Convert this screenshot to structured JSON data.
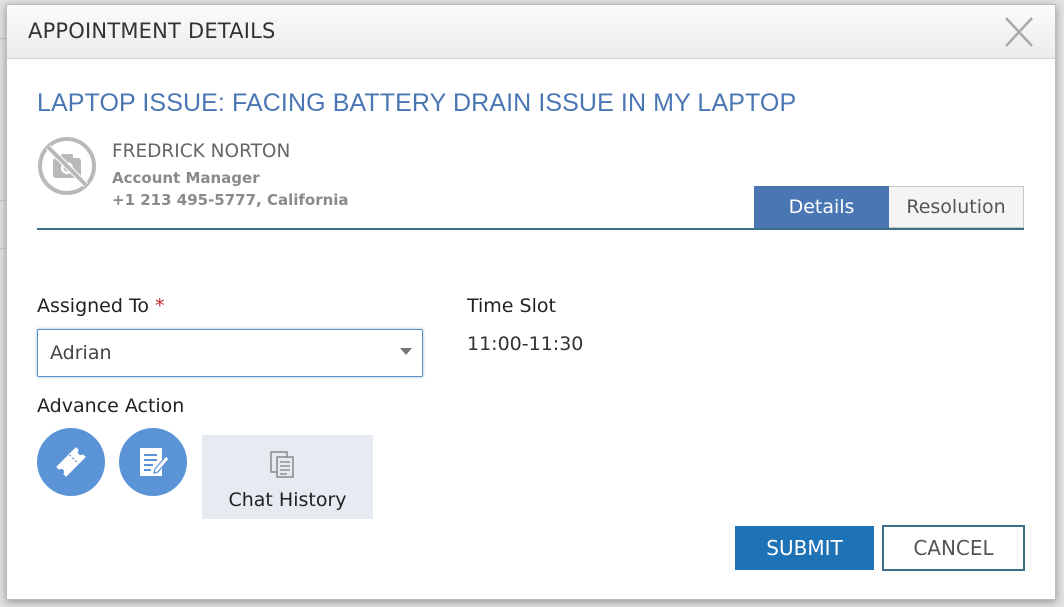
{
  "modal": {
    "title": "APPOINTMENT DETAILS"
  },
  "issue": {
    "title": "LAPTOP ISSUE: FACING BATTERY DRAIN ISSUE IN MY LAPTOP"
  },
  "contact": {
    "name": "FREDRICK NORTON",
    "role": "Account Manager",
    "phone_location": "+1 213 495-5777, California",
    "avatar_icon": "no-photo-camera-icon"
  },
  "tabs": [
    {
      "label": "Details",
      "active": true
    },
    {
      "label": "Resolution",
      "active": false
    }
  ],
  "form": {
    "assigned_to": {
      "label": "Assigned To",
      "required_mark": "*",
      "value": "Adrian"
    },
    "time_slot": {
      "label": "Time Slot",
      "value": "11:00-11:30"
    },
    "advance_action": {
      "label": "Advance Action",
      "actions": [
        {
          "icon": "ticket-icon"
        },
        {
          "icon": "edit-note-icon"
        }
      ],
      "chat_history": {
        "label": "Chat History",
        "icon": "documents-icon"
      }
    }
  },
  "buttons": {
    "submit": "SUBMIT",
    "cancel": "CANCEL"
  },
  "colors": {
    "accent": "#4a76b3",
    "title_blue": "#4a77b4",
    "submit_blue": "#1e73b7",
    "action_circle": "#5b93d7",
    "required": "#c0272d"
  }
}
